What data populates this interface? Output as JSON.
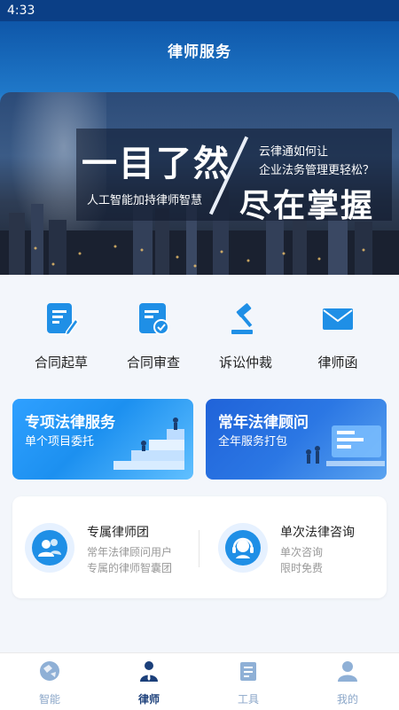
{
  "status_bar": {
    "time": "4:33"
  },
  "header": {
    "title": "律师服务"
  },
  "banner": {
    "headline_left": "一目了然",
    "tagline_left": "人工智能加持律师智慧",
    "headline_right": "尽在掌握",
    "question_line1": "云律通如何让",
    "question_line2": "企业法务管理更轻松？"
  },
  "features": [
    {
      "label": "合同起草",
      "icon": "document-edit-icon"
    },
    {
      "label": "合同审查",
      "icon": "document-check-icon"
    },
    {
      "label": "诉讼仲裁",
      "icon": "gavel-icon"
    },
    {
      "label": "律师函",
      "icon": "envelope-icon"
    }
  ],
  "service_cards": [
    {
      "title": "专项法律服务",
      "subtitle": "单个项目委托"
    },
    {
      "title": "常年法律顾问",
      "subtitle": "全年服务打包"
    }
  ],
  "services": [
    {
      "title": "专属律师团",
      "desc1": "常年法律顾问用户",
      "desc2": "专属的律师智囊团",
      "icon": "team-icon"
    },
    {
      "title": "单次法律咨询",
      "desc1": "单次咨询",
      "desc2": "限时免费",
      "icon": "headset-icon"
    }
  ],
  "tabbar": [
    {
      "label": "智能",
      "icon": "globe-icon",
      "active": false
    },
    {
      "label": "律师",
      "icon": "lawyer-icon",
      "active": true
    },
    {
      "label": "工具",
      "icon": "book-icon",
      "active": false
    },
    {
      "label": "我的",
      "icon": "user-icon",
      "active": false
    }
  ],
  "colors": {
    "primary": "#1f8fe6",
    "header": "#0a4d9f",
    "tab_active": "#1b3f7a"
  }
}
